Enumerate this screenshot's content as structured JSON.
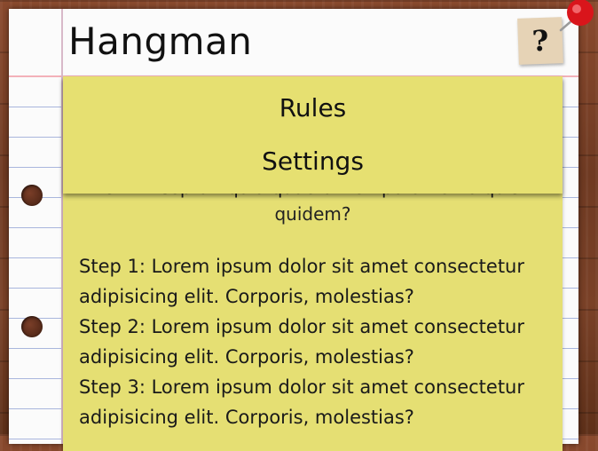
{
  "app": {
    "title": "Hangman",
    "help_label": "?"
  },
  "menu": {
    "items": [
      {
        "label": "Rules"
      },
      {
        "label": "Settings"
      }
    ]
  },
  "rules_card": {
    "intro_partial": "sit. Excepturi quia quaerat tempora nemo quis quidem?",
    "steps": [
      {
        "text": "Step 1: Lorem ipsum dolor sit amet consectetur adipisicing elit. Corporis, molestias?"
      },
      {
        "text": "Step 2: Lorem ipsum dolor sit amet consectetur adipisicing elit. Corporis, molestias?"
      },
      {
        "text": "Step 3: Lorem ipsum dolor sit amet consectetur adipisicing elit. Corporis, molestias?"
      }
    ]
  },
  "colors": {
    "sticky_note": "#e5df73",
    "wood": "#7a4127",
    "paper": "#fbfbfb",
    "ruled_line": "#a9b6dd",
    "pin": "#d9151b"
  },
  "icons": {
    "help": "question-mark-icon",
    "pin": "push-pin-icon"
  }
}
